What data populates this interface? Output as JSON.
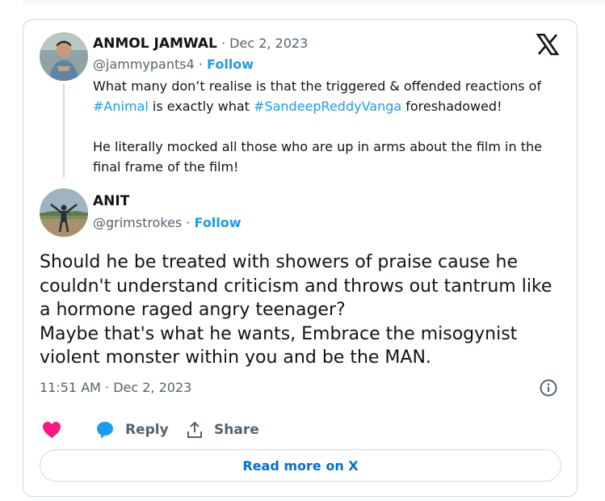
{
  "quoted_tweet": {
    "author_name": "ANMOL JAMWAL",
    "date_sep": " · ",
    "date": "Dec 2, 2023",
    "handle": "@jammypants4",
    "follow_sep": " · ",
    "follow_label": "Follow",
    "text": {
      "line1_pre": "What many don’t realise is that the triggered & offended reactions of ",
      "hashtag1": "#Animal",
      "line1_mid": " is exactly what ",
      "hashtag2": "#SandeepReddyVanga",
      "line1_post": " foreshadowed!",
      "para2": "He literally mocked all those who are up in arms about the film in the final frame of the film!"
    }
  },
  "tweet": {
    "author_name": "ANIT",
    "handle": "@grimstrokes",
    "follow_sep": " · ",
    "follow_label": "Follow",
    "text_para1": "Should he be treated with showers of praise cause he couldn't understand criticism and throws out tantrum like a hormone raged angry teenager?",
    "text_para2": "Maybe that's what he wants, Embrace the misogynist violent monster within you and be the MAN.",
    "timestamp": "11:51 AM · Dec 2, 2023"
  },
  "actions": {
    "like_icon": "heart-icon",
    "reply_label": "Reply",
    "share_label": "Share"
  },
  "read_more_label": "Read more on X",
  "colors": {
    "accent": "#1d9bf0",
    "like": "#f91880",
    "muted": "#536471",
    "border": "#cfd9de",
    "link_button": "#006fd6"
  }
}
